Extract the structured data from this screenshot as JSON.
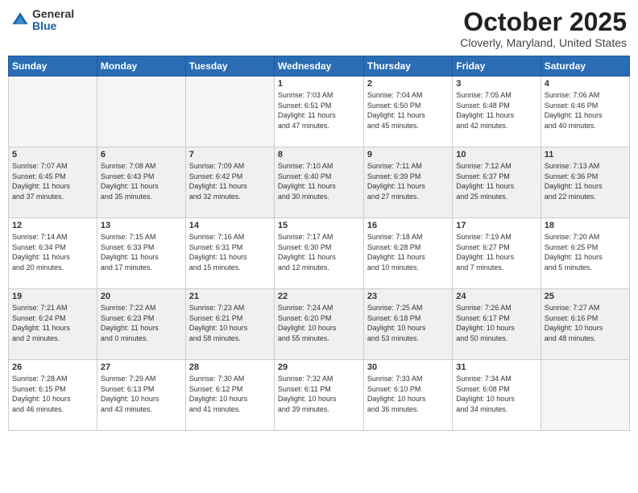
{
  "header": {
    "logo_general": "General",
    "logo_blue": "Blue",
    "month": "October 2025",
    "location": "Cloverly, Maryland, United States"
  },
  "days_of_week": [
    "Sunday",
    "Monday",
    "Tuesday",
    "Wednesday",
    "Thursday",
    "Friday",
    "Saturday"
  ],
  "weeks": [
    [
      {
        "day": "",
        "info": ""
      },
      {
        "day": "",
        "info": ""
      },
      {
        "day": "",
        "info": ""
      },
      {
        "day": "1",
        "info": "Sunrise: 7:03 AM\nSunset: 6:51 PM\nDaylight: 11 hours\nand 47 minutes."
      },
      {
        "day": "2",
        "info": "Sunrise: 7:04 AM\nSunset: 6:50 PM\nDaylight: 11 hours\nand 45 minutes."
      },
      {
        "day": "3",
        "info": "Sunrise: 7:05 AM\nSunset: 6:48 PM\nDaylight: 11 hours\nand 42 minutes."
      },
      {
        "day": "4",
        "info": "Sunrise: 7:06 AM\nSunset: 6:46 PM\nDaylight: 11 hours\nand 40 minutes."
      }
    ],
    [
      {
        "day": "5",
        "info": "Sunrise: 7:07 AM\nSunset: 6:45 PM\nDaylight: 11 hours\nand 37 minutes."
      },
      {
        "day": "6",
        "info": "Sunrise: 7:08 AM\nSunset: 6:43 PM\nDaylight: 11 hours\nand 35 minutes."
      },
      {
        "day": "7",
        "info": "Sunrise: 7:09 AM\nSunset: 6:42 PM\nDaylight: 11 hours\nand 32 minutes."
      },
      {
        "day": "8",
        "info": "Sunrise: 7:10 AM\nSunset: 6:40 PM\nDaylight: 11 hours\nand 30 minutes."
      },
      {
        "day": "9",
        "info": "Sunrise: 7:11 AM\nSunset: 6:39 PM\nDaylight: 11 hours\nand 27 minutes."
      },
      {
        "day": "10",
        "info": "Sunrise: 7:12 AM\nSunset: 6:37 PM\nDaylight: 11 hours\nand 25 minutes."
      },
      {
        "day": "11",
        "info": "Sunrise: 7:13 AM\nSunset: 6:36 PM\nDaylight: 11 hours\nand 22 minutes."
      }
    ],
    [
      {
        "day": "12",
        "info": "Sunrise: 7:14 AM\nSunset: 6:34 PM\nDaylight: 11 hours\nand 20 minutes."
      },
      {
        "day": "13",
        "info": "Sunrise: 7:15 AM\nSunset: 6:33 PM\nDaylight: 11 hours\nand 17 minutes."
      },
      {
        "day": "14",
        "info": "Sunrise: 7:16 AM\nSunset: 6:31 PM\nDaylight: 11 hours\nand 15 minutes."
      },
      {
        "day": "15",
        "info": "Sunrise: 7:17 AM\nSunset: 6:30 PM\nDaylight: 11 hours\nand 12 minutes."
      },
      {
        "day": "16",
        "info": "Sunrise: 7:18 AM\nSunset: 6:28 PM\nDaylight: 11 hours\nand 10 minutes."
      },
      {
        "day": "17",
        "info": "Sunrise: 7:19 AM\nSunset: 6:27 PM\nDaylight: 11 hours\nand 7 minutes."
      },
      {
        "day": "18",
        "info": "Sunrise: 7:20 AM\nSunset: 6:25 PM\nDaylight: 11 hours\nand 5 minutes."
      }
    ],
    [
      {
        "day": "19",
        "info": "Sunrise: 7:21 AM\nSunset: 6:24 PM\nDaylight: 11 hours\nand 2 minutes."
      },
      {
        "day": "20",
        "info": "Sunrise: 7:22 AM\nSunset: 6:23 PM\nDaylight: 11 hours\nand 0 minutes."
      },
      {
        "day": "21",
        "info": "Sunrise: 7:23 AM\nSunset: 6:21 PM\nDaylight: 10 hours\nand 58 minutes."
      },
      {
        "day": "22",
        "info": "Sunrise: 7:24 AM\nSunset: 6:20 PM\nDaylight: 10 hours\nand 55 minutes."
      },
      {
        "day": "23",
        "info": "Sunrise: 7:25 AM\nSunset: 6:18 PM\nDaylight: 10 hours\nand 53 minutes."
      },
      {
        "day": "24",
        "info": "Sunrise: 7:26 AM\nSunset: 6:17 PM\nDaylight: 10 hours\nand 50 minutes."
      },
      {
        "day": "25",
        "info": "Sunrise: 7:27 AM\nSunset: 6:16 PM\nDaylight: 10 hours\nand 48 minutes."
      }
    ],
    [
      {
        "day": "26",
        "info": "Sunrise: 7:28 AM\nSunset: 6:15 PM\nDaylight: 10 hours\nand 46 minutes."
      },
      {
        "day": "27",
        "info": "Sunrise: 7:29 AM\nSunset: 6:13 PM\nDaylight: 10 hours\nand 43 minutes."
      },
      {
        "day": "28",
        "info": "Sunrise: 7:30 AM\nSunset: 6:12 PM\nDaylight: 10 hours\nand 41 minutes."
      },
      {
        "day": "29",
        "info": "Sunrise: 7:32 AM\nSunset: 6:11 PM\nDaylight: 10 hours\nand 39 minutes."
      },
      {
        "day": "30",
        "info": "Sunrise: 7:33 AM\nSunset: 6:10 PM\nDaylight: 10 hours\nand 36 minutes."
      },
      {
        "day": "31",
        "info": "Sunrise: 7:34 AM\nSunset: 6:08 PM\nDaylight: 10 hours\nand 34 minutes."
      },
      {
        "day": "",
        "info": ""
      }
    ]
  ]
}
